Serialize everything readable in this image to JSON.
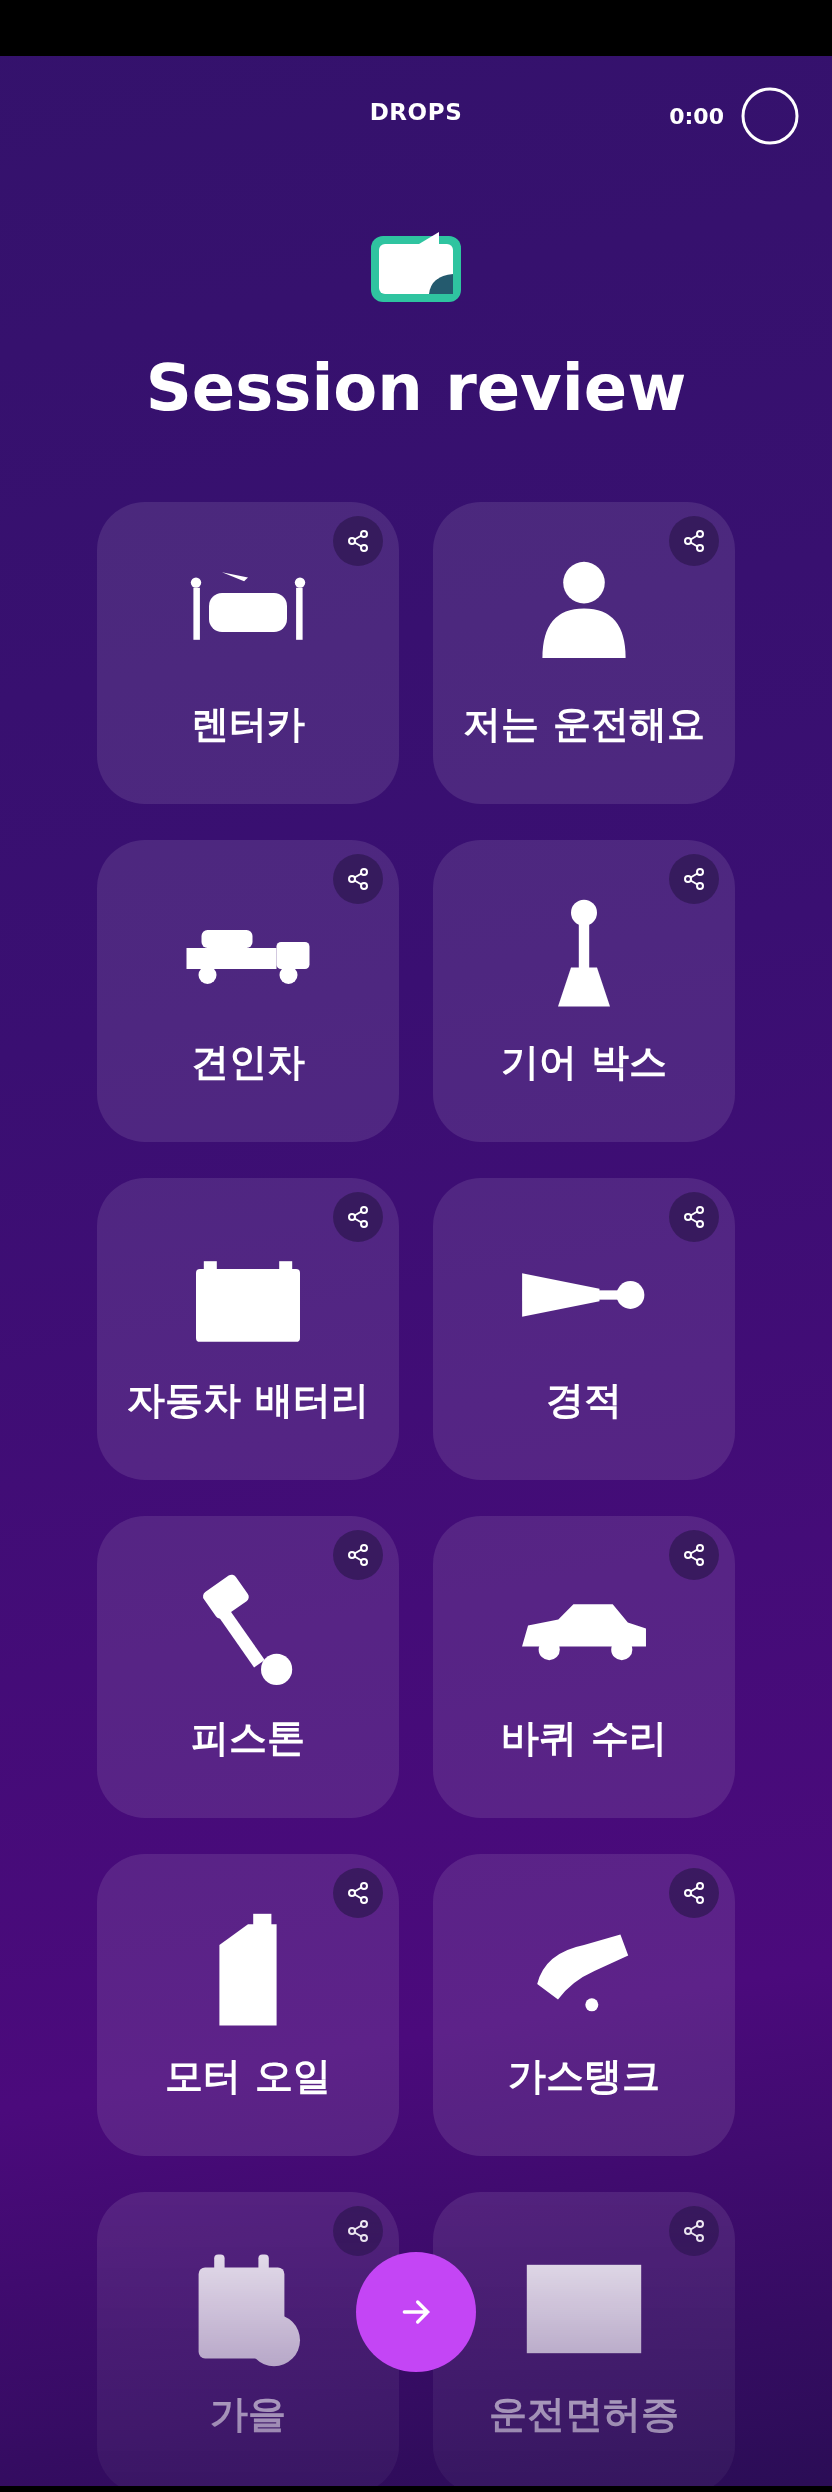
{
  "header": {
    "title": "DROPS",
    "timer": "0:00"
  },
  "title": "Session review",
  "cards": [
    {
      "label": "렌터카"
    },
    {
      "label": "저는 운전해요"
    },
    {
      "label": "견인차"
    },
    {
      "label": "기어 박스"
    },
    {
      "label": "자동차 배터리"
    },
    {
      "label": "경적"
    },
    {
      "label": "피스톤"
    },
    {
      "label": "바퀴 수리"
    },
    {
      "label": "모터 오일"
    },
    {
      "label": "가스탱크"
    },
    {
      "label": "가을"
    },
    {
      "label": "운전면허증"
    }
  ]
}
